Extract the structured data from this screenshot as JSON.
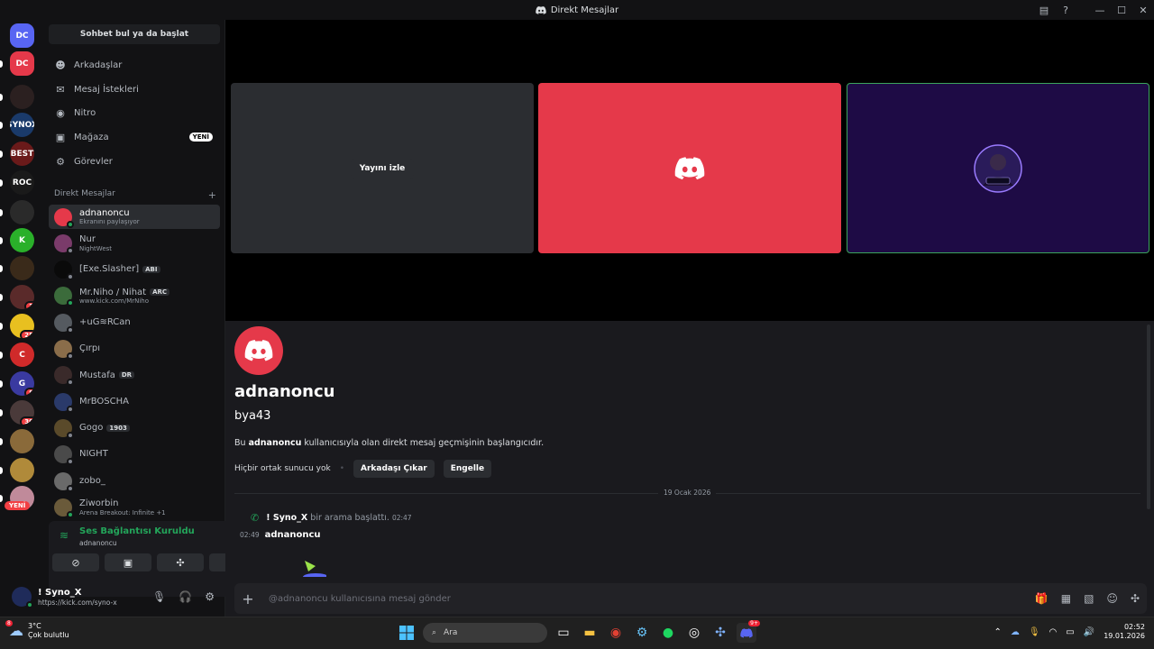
{
  "window": {
    "title": "Direkt Mesajlar"
  },
  "sidebar": {
    "search_label": "Sohbet bul ya da başlat",
    "nav": [
      {
        "label": "Arkadaşlar",
        "icon": "friends-icon"
      },
      {
        "label": "Mesaj İstekleri",
        "icon": "mail-icon"
      },
      {
        "label": "Nitro",
        "icon": "nitro-icon"
      },
      {
        "label": "Mağaza",
        "icon": "shop-icon",
        "badge": "YENİ"
      },
      {
        "label": "Görevler",
        "icon": "quests-icon"
      }
    ],
    "dm_header": "Direkt Mesajlar",
    "dm_add": "+",
    "dms": [
      {
        "name": "adnanoncu",
        "sub": "Ekranını paylaşıyor",
        "tag": "",
        "online": true,
        "color": "#e5394a",
        "active": true
      },
      {
        "name": "Nur",
        "sub": "NightWest",
        "tag": "",
        "online": false,
        "color": "#7a3b6a",
        "active": false
      },
      {
        "name": "[Exe.Slasher]",
        "sub": "",
        "tag": "ABI",
        "online": false,
        "color": "#0a0a0a",
        "active": false
      },
      {
        "name": "Mr.Niho / Nihat",
        "sub": "www.kick.com/MrNiho",
        "tag": "ARC",
        "online": true,
        "color": "#3b6b3b",
        "active": false
      },
      {
        "name": "+uG≋RCan",
        "sub": "",
        "tag": "",
        "online": false,
        "color": "#555a60",
        "active": false
      },
      {
        "name": "Çırpı",
        "sub": "",
        "tag": "",
        "online": false,
        "color": "#8a6d4a",
        "active": false
      },
      {
        "name": "Mustafa",
        "sub": "",
        "tag": "DR",
        "online": false,
        "color": "#3a2a2a",
        "active": false
      },
      {
        "name": "MrBOSCHA",
        "sub": "",
        "tag": "",
        "online": false,
        "color": "#2a3a6a",
        "active": false
      },
      {
        "name": "Gogo",
        "sub": "",
        "tag": "1903",
        "online": false,
        "color": "#5a4a2a",
        "active": false
      },
      {
        "name": "NIGHT",
        "sub": "",
        "tag": "",
        "online": false,
        "color": "#4a4a4a",
        "active": false
      },
      {
        "name": "zobo_",
        "sub": "",
        "tag": "",
        "online": false,
        "color": "#6a6a6a",
        "active": false
      },
      {
        "name": "Ziworbin",
        "sub": "Arena Breakout: Infinite +1",
        "tag": "",
        "online": true,
        "color": "#6a5a3a",
        "active": false
      }
    ]
  },
  "guilds": [
    {
      "label": "DC",
      "color": "#5865f2",
      "badge": ""
    },
    {
      "label": "DC",
      "color": "#e5394a",
      "badge": ""
    },
    {
      "label": "",
      "color": "#2b2020",
      "badge": ""
    },
    {
      "label": "SYNOX",
      "color": "#1a3a6a",
      "badge": ""
    },
    {
      "label": "BEST",
      "color": "#6a1a1a",
      "badge": ""
    },
    {
      "label": "ROC",
      "color": "#1a1a1a",
      "badge": ""
    },
    {
      "label": "",
      "color": "#2a2a2a",
      "badge": ""
    },
    {
      "label": "K",
      "color": "#2ab02a",
      "badge": ""
    },
    {
      "label": "",
      "color": "#3a2a1a",
      "badge": ""
    },
    {
      "label": "",
      "color": "#5a2a2a",
      "badge": "3"
    },
    {
      "label": "",
      "color": "#e8c020",
      "badge": "25"
    },
    {
      "label": "C",
      "color": "#d02a2a",
      "badge": ""
    },
    {
      "label": "G",
      "color": "#3a3aa0",
      "badge": "8"
    },
    {
      "label": "",
      "color": "#4a3a3a",
      "badge": "30"
    },
    {
      "label": "",
      "color": "#8a6a3a",
      "badge": ""
    },
    {
      "label": "",
      "color": "#b08a3a",
      "badge": ""
    },
    {
      "label": "",
      "color": "#c08a9a",
      "badge": ""
    }
  ],
  "guild_new_label": "YENİ",
  "voice": {
    "title": "Ses Bağlantısı Kuruldu",
    "channel": "adnanoncu"
  },
  "user": {
    "name": "! Syno_X",
    "status": "https://kick.com/syno-x"
  },
  "stage": {
    "watch_label": "Yayını izle",
    "tile_colors": [
      "#2b2d31",
      "#e5394a",
      "#1e0b45"
    ],
    "active_border": "#3ba55c"
  },
  "chat": {
    "profile_name": "adnanoncu",
    "profile_username": "bya43",
    "desc_prefix": "Bu ",
    "desc_bold": "adnanoncu",
    "desc_suffix": " kullanıcısıyla olan direkt mesaj geçmişinin başlangıcıdır.",
    "no_mutual": "Hiçbir ortak sunucu yok",
    "sep": "•",
    "remove_friend": "Arkadaşı Çıkar",
    "block": "Engelle",
    "date": "19 Ocak 2026",
    "call_user": "! Syno_X",
    "call_text": "bir arama başlattı.",
    "call_time": "02:47",
    "msg_time": "02:49",
    "msg_author": "adnanoncu",
    "composer_placeholder": "@adnanoncu kullanıcısına mesaj gönder"
  },
  "taskbar": {
    "temp": "3°C",
    "weather": "Çok bulutlu",
    "weather_badge": "8",
    "search": "Ara",
    "time": "02:52",
    "date": "19.01.2026",
    "discord_badge": "9+"
  }
}
